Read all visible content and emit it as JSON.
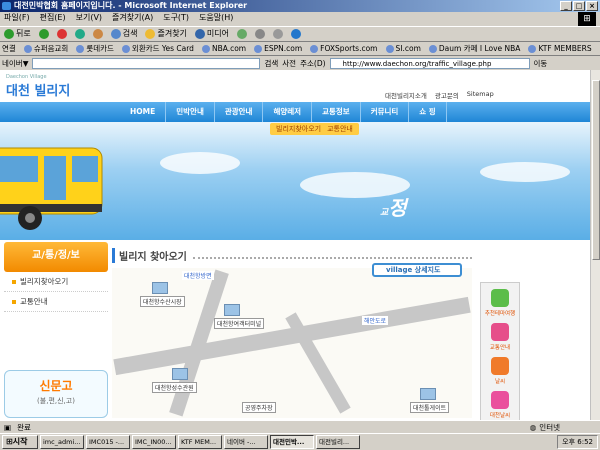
{
  "window": {
    "title": "대전민박협회 홈페이지입니다. - Microsoft Internet Explorer"
  },
  "menu": [
    "파일(F)",
    "편집(E)",
    "보기(V)",
    "즐겨찾기(A)",
    "도구(T)",
    "도움말(H)"
  ],
  "toolbar": {
    "back": "뒤로",
    "search": "검색",
    "favorites": "즐겨찾기",
    "media": "미디어"
  },
  "links": {
    "label": "연결",
    "items": [
      "슈퍼음교회",
      "롯데카드",
      "외환카드 Yes Card",
      "NBA.com",
      "ESPN.com",
      "FOXSports.com",
      "SI.com",
      "Daum 카페 I Love NBA",
      "KTF MEMBERS"
    ]
  },
  "navbar": {
    "naver": "네이버▼",
    "search": "검색",
    "dict": "사전",
    "address_label": "주소(D)",
    "url": "http://www.daechon.org/traffic_village.php",
    "go": "이동"
  },
  "site": {
    "logo": "대천 빌리지",
    "logo_sub": "Daechon Village",
    "toplinks": [
      "대천빌리지소개",
      "광고문의",
      "Sitemap"
    ],
    "nav": [
      "HOME",
      "민박안내",
      "관광안내",
      "해양레저",
      "교통정보",
      "커뮤니티",
      "쇼 핑"
    ],
    "subnav": [
      "빌리지찾아오기",
      "교통안내"
    ],
    "slogan": "정",
    "slogan_small": "교",
    "left_title": "교/통/정/보",
    "left_items": [
      "빌리지찾아오기",
      "교통안내"
    ],
    "ask_title": "신문고",
    "ask_sub": "(불,편,신,고)",
    "content_title": "빌리지 찾아오기",
    "detail_button": "village 상세지도",
    "map_labels": [
      "대천항수산시장",
      "대천항여객터미널",
      "대천항성수관원",
      "공영주차장",
      "대천톨게이트",
      "대천항방면",
      "해안도로"
    ],
    "right_items": [
      "추천테마여행",
      "교통안내",
      "날씨",
      "대천날씨"
    ]
  },
  "status": {
    "text": "완료",
    "zone": "인터넷"
  },
  "taskbar": {
    "start": "시작",
    "tasks": [
      "imc_admi...",
      "IMC015 -...",
      "IMC_IN00...",
      "KTF MEM...",
      "네이버 -...",
      "대전민박...",
      "대전빌리..."
    ],
    "clock": "오후 6:52"
  }
}
